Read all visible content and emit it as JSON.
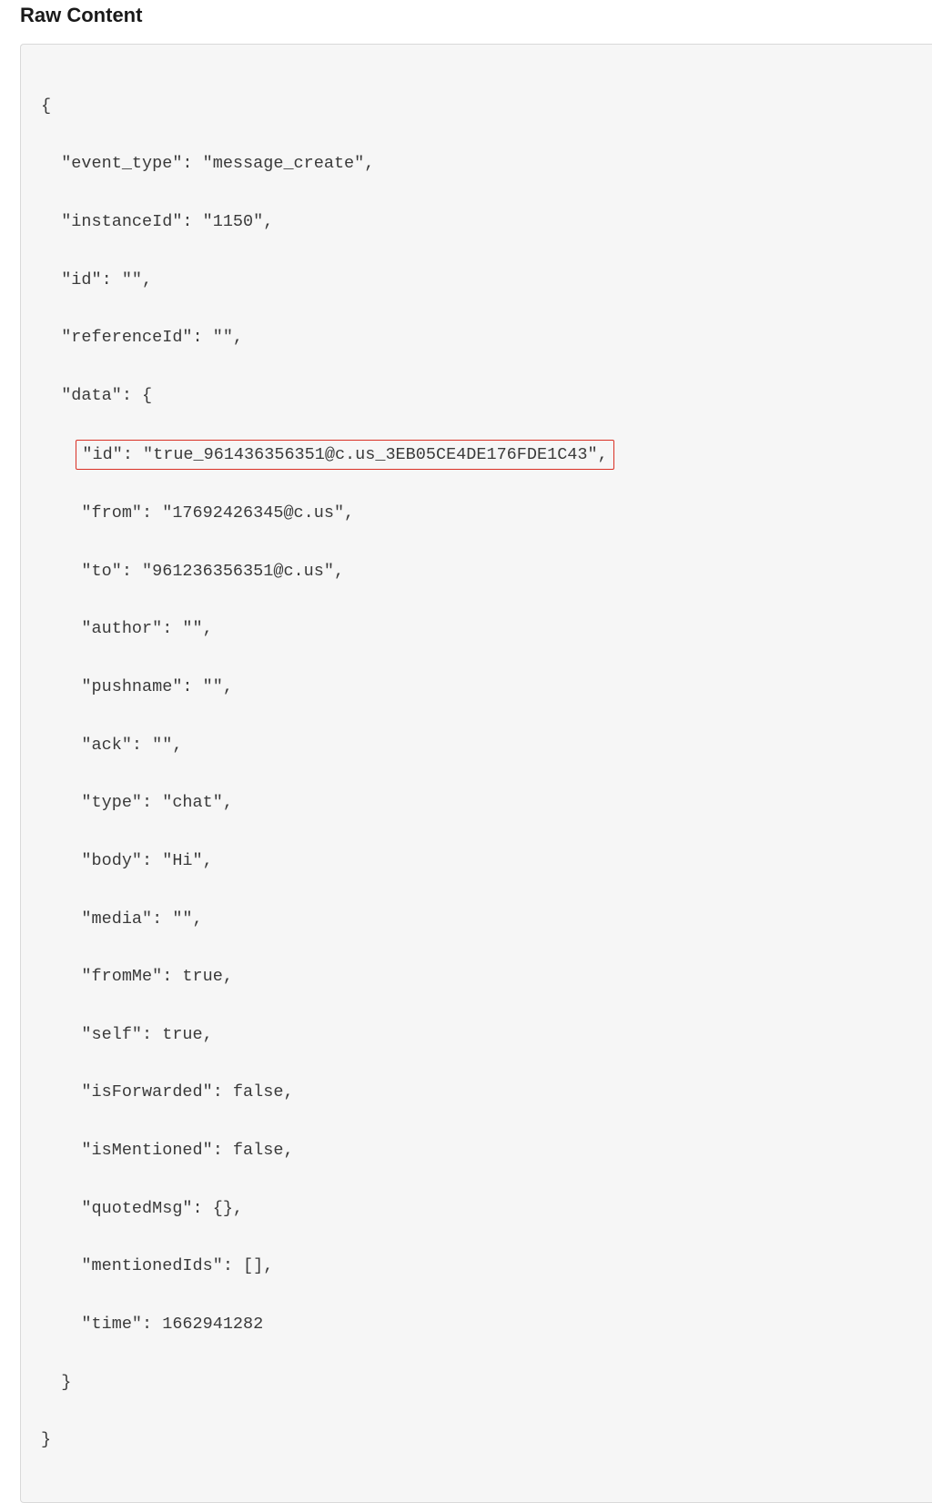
{
  "title": "Raw Content",
  "code": {
    "l0": "{",
    "l1": "\"event_type\": \"message_create\",",
    "l2": "\"instanceId\": \"1150\",",
    "l3": "\"id\": \"\",",
    "l4": "\"referenceId\": \"\",",
    "l5": "\"data\": {",
    "l6": "\"id\": \"true_961436356351@c.us_3EB05CE4DE176FDE1C43\",",
    "l7": "\"from\": \"17692426345@c.us\",",
    "l8": "\"to\": \"961236356351@c.us\",",
    "l9": "\"author\": \"\",",
    "l10": "\"pushname\": \"\",",
    "l11": "\"ack\": \"\",",
    "l12": "\"type\": \"chat\",",
    "l13": "\"body\": \"Hi\",",
    "l14": "\"media\": \"\",",
    "l15": "\"fromMe\": true,",
    "l16": "\"self\": true,",
    "l17": "\"isForwarded\": false,",
    "l18": "\"isMentioned\": false,",
    "l19": "\"quotedMsg\": {},",
    "l20": "\"mentionedIds\": [],",
    "l21": "\"time\": 1662941282",
    "l22": "}",
    "l23": "}"
  }
}
